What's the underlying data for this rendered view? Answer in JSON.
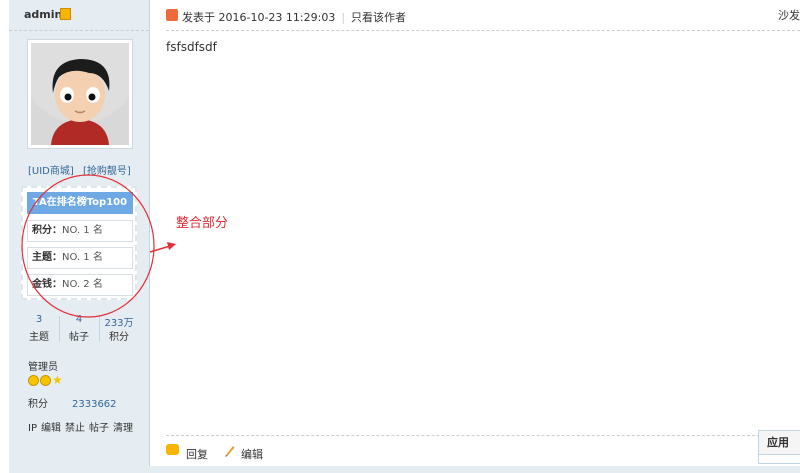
{
  "sidebar": {
    "username": "admin",
    "links": [
      "[UID商城]",
      "[抢购靓号]"
    ],
    "rank": {
      "title": "TA在排名榜Top100",
      "rows": [
        {
          "label": "积分：",
          "value": "NO. 1 名"
        },
        {
          "label": "主题：",
          "value": "NO. 1 名"
        },
        {
          "label": "金钱：",
          "value": "NO. 2 名"
        }
      ]
    },
    "stats": [
      {
        "num": "3",
        "label": "主题"
      },
      {
        "num": "4",
        "label": "帖子"
      },
      {
        "num": "233万",
        "label": "积分"
      }
    ],
    "group": "管理员",
    "points_label": "积分",
    "points_value": "2333662",
    "admin_actions": [
      "IP",
      "编辑",
      "禁止",
      "帖子",
      "清理"
    ]
  },
  "post": {
    "meta": "发表于 2016-10-23 11:29:03",
    "only_author": "只看该作者",
    "floor": "沙发",
    "content": "fsfsdfsdf"
  },
  "annotation": "整合部分",
  "footer": {
    "reply": "回复",
    "edit": "编辑"
  },
  "app_box": {
    "title": "应用"
  },
  "colors": {
    "accent_blue": "#6fa9e5",
    "annotation_red": "#e0303a",
    "sidebar_bg": "#e5edf2"
  }
}
